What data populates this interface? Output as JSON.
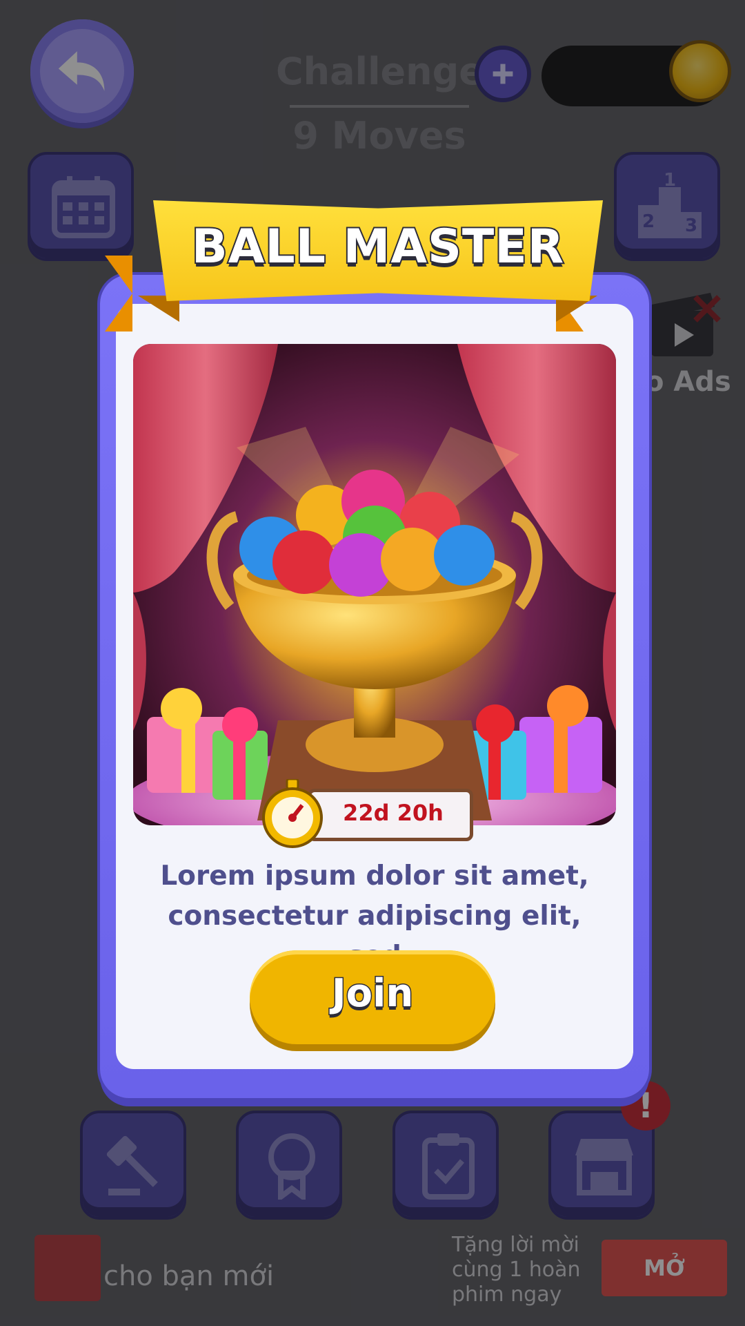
{
  "background": {
    "title": "Challenge",
    "subtitle": "9 Moves",
    "plus_icon": "plus-icon",
    "ads_label": "o Ads",
    "alert_mark": "!",
    "bottom_banner": {
      "text": "cho bạn mới",
      "side_text": "Tặng lời mời cùng 1 hoàn phim ngay",
      "button_label": "MỞ"
    },
    "icons": [
      "back-arrow-icon",
      "calendar-icon",
      "podium-icon",
      "clapperboard-icon",
      "gavel-icon",
      "badge-icon",
      "clipboard-icon",
      "shop-icon"
    ],
    "podium_numbers": [
      "1",
      "2",
      "3"
    ]
  },
  "popup": {
    "title": "BALL MASTER",
    "timer": "22d 20h",
    "description_line1": "Lorem ipsum dolor sit amet,",
    "description_line2": "consectetur adipiscing elit, sed",
    "join_label": "Join",
    "art_icons": [
      "trophy-icon",
      "balls-icon",
      "gift-box-icon",
      "curtain-icon",
      "stopwatch-icon"
    ]
  },
  "colors": {
    "frame_purple": "#7b73f6",
    "ribbon_yellow": "#f7c51a",
    "button_gold": "#f0b500",
    "timer_red": "#c1131f",
    "text_indigo": "#4f4f8d"
  }
}
